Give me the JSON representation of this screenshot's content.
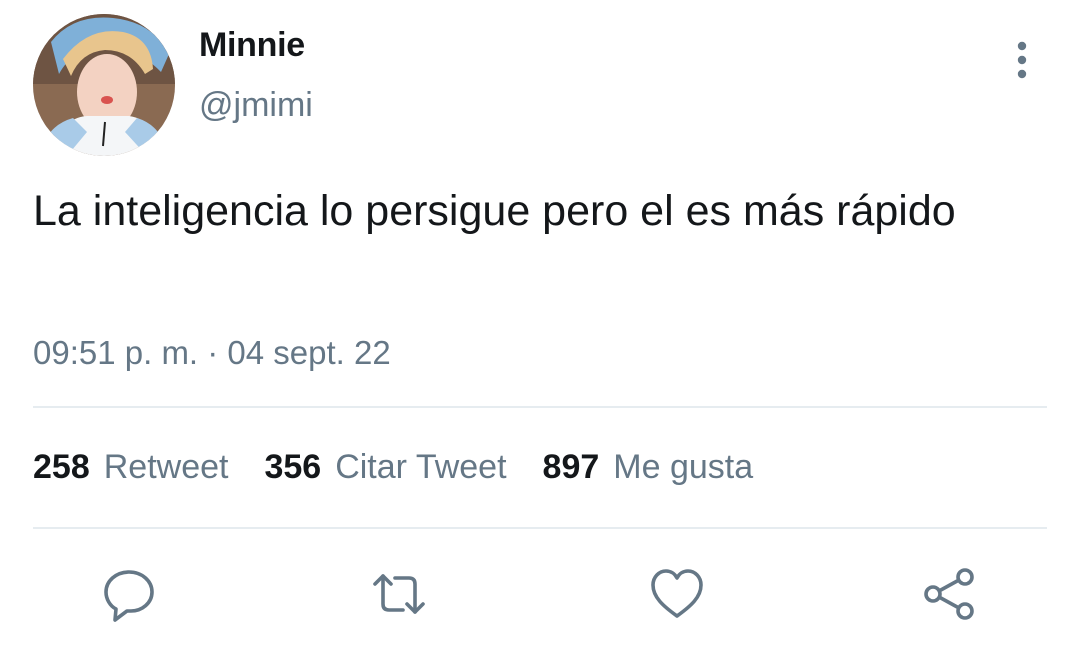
{
  "user": {
    "display_name": "Minnie",
    "handle": "@jmimi"
  },
  "tweet": {
    "text": "La inteligencia lo persigue pero el es más rápido",
    "timestamp": "09:51 p. m. · 04 sept. 22"
  },
  "stats": {
    "retweets": {
      "count": "258",
      "label": "Retweet"
    },
    "quotes": {
      "count": "356",
      "label": "Citar Tweet"
    },
    "likes": {
      "count": "897",
      "label": "Me gusta"
    }
  },
  "actions": [
    "reply-icon",
    "retweet-icon",
    "like-icon",
    "share-icon"
  ],
  "colors": {
    "text": "#14171a",
    "secondary": "#657786",
    "divider": "#e6ecf0",
    "icon": "#657786"
  }
}
